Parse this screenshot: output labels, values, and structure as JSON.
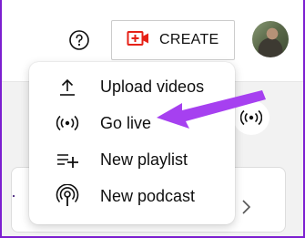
{
  "colors": {
    "accent_arrow": "#a640f0",
    "create_icon_red": "#e62117",
    "frame_purple": "#7c1fd0"
  },
  "header": {
    "help_icon": "help-circle-icon",
    "create_button": {
      "icon": "video-add-icon",
      "label": "CREATE"
    },
    "avatar": "user-avatar-photo"
  },
  "create_menu": {
    "items": [
      {
        "icon": "upload-icon",
        "label": "Upload videos"
      },
      {
        "icon": "live-broadcast-icon",
        "label": "Go live"
      },
      {
        "icon": "playlist-add-icon",
        "label": "New playlist"
      },
      {
        "icon": "podcast-icon",
        "label": "New podcast"
      }
    ]
  },
  "annotation": {
    "arrow_points_to": "Go live"
  }
}
